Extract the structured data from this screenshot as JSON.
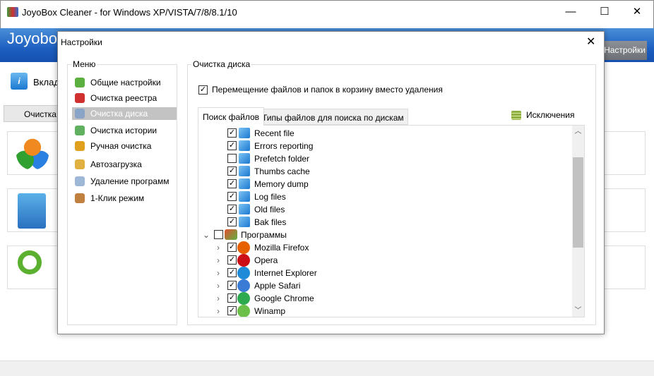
{
  "window": {
    "title": "JoyoBox Cleaner - for Windows XP/VISTA/7/8/8.1/10",
    "minimize": "—",
    "maximize": "☐",
    "close": "✕"
  },
  "header": {
    "title": "Joyobox Cleaner",
    "settings_button": "Настройки"
  },
  "background": {
    "info_label": "Вкладк",
    "tab_label": "Очистка р"
  },
  "dialog": {
    "title": "Настройки",
    "close": "✕",
    "menu": {
      "title": "Меню",
      "items": [
        {
          "label": "Общие настройки",
          "color": "#5cb040"
        },
        {
          "label": "Очистка реестра",
          "color": "#d03030"
        },
        {
          "label": "Очистка диска",
          "color": "#8aa4c8"
        },
        {
          "label": "Очистка истории",
          "color": "#60b060"
        },
        {
          "label": "Ручная очистка",
          "color": "#e0a020"
        },
        {
          "label": "Автозагрузка",
          "color": "#e0b040"
        },
        {
          "label": "Удаление программ",
          "color": "#a0b8d8"
        },
        {
          "label": "1-Клик режим",
          "color": "#c08040"
        }
      ],
      "selected": 2
    },
    "disk": {
      "title": "Очистка диска",
      "recycle_option": {
        "label": "Перемещение файлов и папок в корзину вместо удаления",
        "checked": true
      },
      "tabs": [
        "Поиск файлов",
        "Типы файлов для поиска по дискам"
      ],
      "exclusions": "Исключения",
      "files": [
        {
          "label": "Recent file",
          "checked": true
        },
        {
          "label": "Errors reporting",
          "checked": true
        },
        {
          "label": "Prefetch folder",
          "checked": false
        },
        {
          "label": "Thumbs cache",
          "checked": true
        },
        {
          "label": "Memory dump",
          "checked": true
        },
        {
          "label": "Log files",
          "checked": true
        },
        {
          "label": "Old files",
          "checked": true
        },
        {
          "label": "Bak files",
          "checked": true
        }
      ],
      "programs": {
        "label": "Программы",
        "checked": false,
        "items": [
          {
            "label": "Mozilla Firefox",
            "checked": true,
            "color": "#e66000"
          },
          {
            "label": "Opera",
            "checked": true,
            "color": "#cc0f16"
          },
          {
            "label": "Internet Explorer",
            "checked": true,
            "color": "#1e8ad8"
          },
          {
            "label": "Apple Safari",
            "checked": true,
            "color": "#3a7bd5"
          },
          {
            "label": "Google Chrome",
            "checked": true,
            "color": "#2da94f"
          },
          {
            "label": "Winamp",
            "checked": true,
            "color": "#6cc04a"
          }
        ]
      }
    }
  }
}
